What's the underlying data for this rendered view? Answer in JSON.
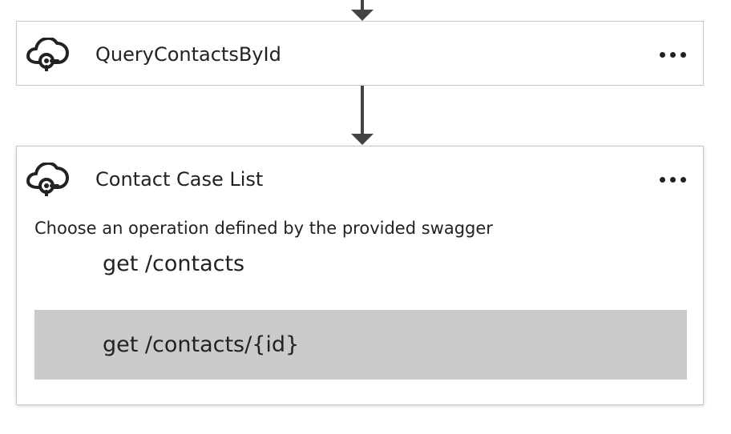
{
  "cards": [
    {
      "title": "QueryContactsById",
      "icon": "cloud-connector-icon",
      "more_icon": "more-options-icon"
    },
    {
      "title": "Contact Case List",
      "icon": "cloud-connector-icon",
      "more_icon": "more-options-icon",
      "prompt": "Choose an operation defined by the provided swagger",
      "operations": [
        {
          "label": "get /contacts",
          "selected": false
        },
        {
          "label": "get /contacts/{id}",
          "selected": true
        }
      ]
    }
  ],
  "colors": {
    "connector": "#444444",
    "card_border": "#c8c8c8",
    "selected_background": "#cacaca",
    "text": "#222222"
  }
}
